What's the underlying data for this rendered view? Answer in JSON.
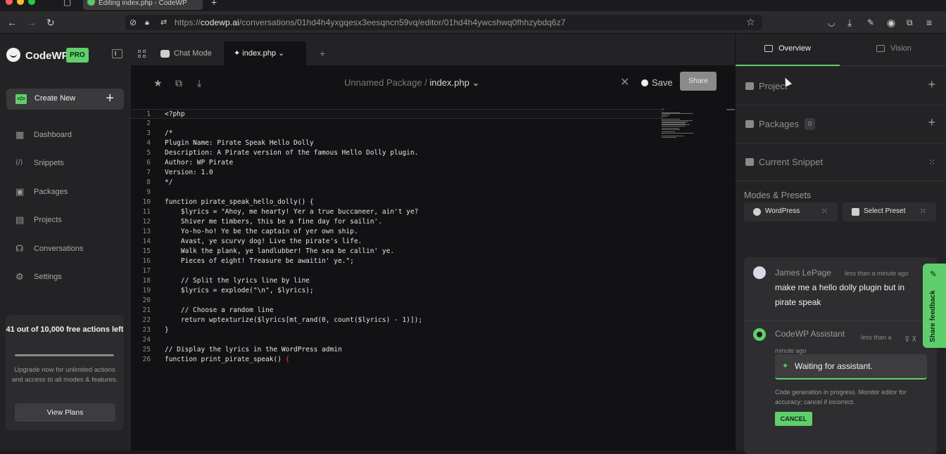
{
  "browser": {
    "tab_title": "Editing index.php - CodeWP",
    "url_domain": "codewp.ai",
    "url_prefix": "https://",
    "url_path": "/conversations/01hd4h4yxgqesx3eesqncn59vq/editor/01hd4h4ywcshwq0fhhzybdq6z7"
  },
  "sidebar": {
    "brand": "CodeWP",
    "badge": "PRO",
    "create_new": "Create New",
    "items": [
      {
        "label": "Dashboard",
        "icon": "dashboard-icon"
      },
      {
        "label": "Snippets",
        "icon": "code-icon"
      },
      {
        "label": "Packages",
        "icon": "package-icon"
      },
      {
        "label": "Projects",
        "icon": "terminal-icon"
      },
      {
        "label": "Conversations",
        "icon": "headphones-icon"
      },
      {
        "label": "Settings",
        "icon": "gear-icon"
      }
    ],
    "usage": {
      "title": "41 out of 10,000 free actions left",
      "progress_fraction": 0.996,
      "description": "Upgrade now for unlimited actions and access to all modes & features.",
      "button": "View Plans"
    }
  },
  "editor": {
    "tabs": {
      "chat_mode": "Chat Mode",
      "file": "index.php"
    },
    "breadcrumb_package": "Unnamed Package /",
    "breadcrumb_file": "index.php",
    "save_label": "Save",
    "share_label": "Share",
    "lines": [
      {
        "n": "1",
        "t": "<?php"
      },
      {
        "n": "2",
        "t": ""
      },
      {
        "n": "3",
        "t": "/*"
      },
      {
        "n": "4",
        "t": "Plugin Name: Pirate Speak Hello Dolly"
      },
      {
        "n": "5",
        "t": "Description: A Pirate version of the famous Hello Dolly plugin."
      },
      {
        "n": "6",
        "t": "Author: WP Pirate"
      },
      {
        "n": "7",
        "t": "Version: 1.0"
      },
      {
        "n": "8",
        "t": "*/"
      },
      {
        "n": "9",
        "t": ""
      },
      {
        "n": "10",
        "t": "function pirate_speak_hello_dolly() {"
      },
      {
        "n": "11",
        "t": "    $lyrics = \"Ahoy, me hearty! Yer a true buccaneer, ain't ye?"
      },
      {
        "n": "12",
        "t": "    Shiver me timbers, this be a fine day for sailin'."
      },
      {
        "n": "13",
        "t": "    Yo-ho-ho! Ye be the captain of yer own ship."
      },
      {
        "n": "14",
        "t": "    Avast, ye scurvy dog! Live the pirate's life."
      },
      {
        "n": "15",
        "t": "    Walk the plank, ye landlubber! The sea be callin' ye."
      },
      {
        "n": "16",
        "t": "    Pieces of eight! Treasure be awaitin' ye.\";"
      },
      {
        "n": "17",
        "t": ""
      },
      {
        "n": "18",
        "t": "    // Split the lyrics line by line"
      },
      {
        "n": "19",
        "t": "    $lyrics = explode(\"\\n\", $lyrics);"
      },
      {
        "n": "20",
        "t": ""
      },
      {
        "n": "21",
        "t": "    // Choose a random line"
      },
      {
        "n": "22",
        "t": "    return wptexturize($lyrics[mt_rand(0, count($lyrics) - 1)]);"
      },
      {
        "n": "23",
        "t": "}"
      },
      {
        "n": "24",
        "t": ""
      },
      {
        "n": "25",
        "t": "// Display the lyrics in the WordPress admin"
      },
      {
        "n": "26",
        "t": "function print_pirate_speak() "
      }
    ],
    "last_brace": "{"
  },
  "right_panel": {
    "tabs": {
      "overview": "Overview",
      "vision": "Vision"
    },
    "sections": {
      "project": "Project",
      "packages": "Packages",
      "packages_count": "0",
      "current_snippet": "Current Snippet"
    },
    "modes_title": "Modes & Presets",
    "presets": {
      "wordpress": "WordPress",
      "select": "Select Preset"
    },
    "chat": {
      "user_name": "James LePage",
      "user_time": "less than a minute ago",
      "user_message": "make me a hello dolly plugin but in pirate speak",
      "assistant_name": "CodeWP Assistant",
      "assistant_time": "less than a minute ago",
      "waiting": "Waiting for assistant.",
      "note": "Code generation in progress. Monitor editor for accuracy; cancel if incorrect.",
      "cancel": "CANCEL"
    },
    "feedback": "Share feedback"
  },
  "colors": {
    "accent": "#5fcf6b",
    "background": "#121214",
    "panel": "#232325"
  }
}
